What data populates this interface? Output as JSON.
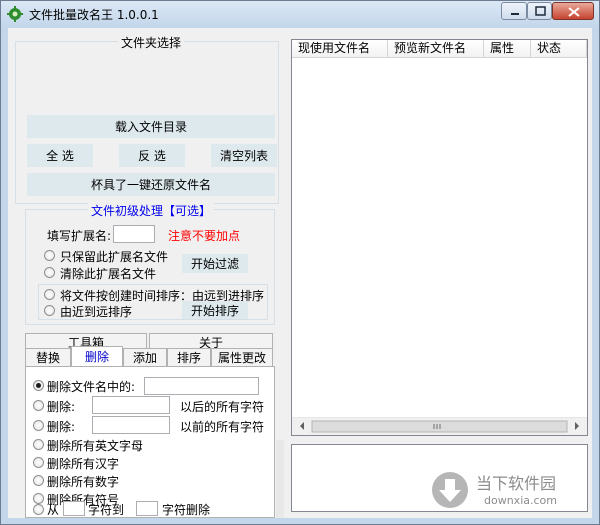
{
  "window": {
    "title": "文件批量改名王  1.0.0.1",
    "icon": "gear-icon"
  },
  "folder_section": {
    "legend": "文件夹选择",
    "load_button": "载入文件目录",
    "select_all": "全 选",
    "invert_select": "反 选",
    "clear_list": "清空列表",
    "restore_button": "杯具了一键还原文件名"
  },
  "pre_section": {
    "legend": "文件初级处理【可选】",
    "ext_label": "填写扩展名:",
    "ext_value": "",
    "ext_warning": "注意不要加点",
    "ext_warning_color": "#ff0000",
    "keep_ext_only": "只保留此扩展名文件",
    "remove_ext": "清除此扩展名文件",
    "filter_button": "开始过滤",
    "sort_far_near": "将文件按创建时间排序：由远到进排序",
    "sort_near_far": "由近到远排序",
    "sort_button": "开始排序"
  },
  "tabs": {
    "row1": [
      "工具箱",
      "关于"
    ],
    "row2": [
      "替换",
      "删除",
      "添加",
      "排序",
      "属性更改"
    ],
    "selected": "删除"
  },
  "delete_tab": {
    "opt1": "删除文件名中的:",
    "opt2_label": "删除:",
    "opt2_suffix": "以后的所有字符",
    "opt3_label": "删除:",
    "opt3_suffix": "以前的所有字符",
    "opt4": "删除所有英文字母",
    "opt5": "删除所有汉字",
    "opt6": "删除所有数字",
    "opt7": "删除所有符号",
    "opt8_from": "从",
    "opt8_mid": "字符到",
    "opt8_end": "字符删除"
  },
  "file_list": {
    "columns": [
      "现使用文件名",
      "预览新文件名",
      "属性",
      "状态"
    ]
  },
  "watermark": {
    "name": "当下软件园",
    "url": "downxia.com"
  }
}
